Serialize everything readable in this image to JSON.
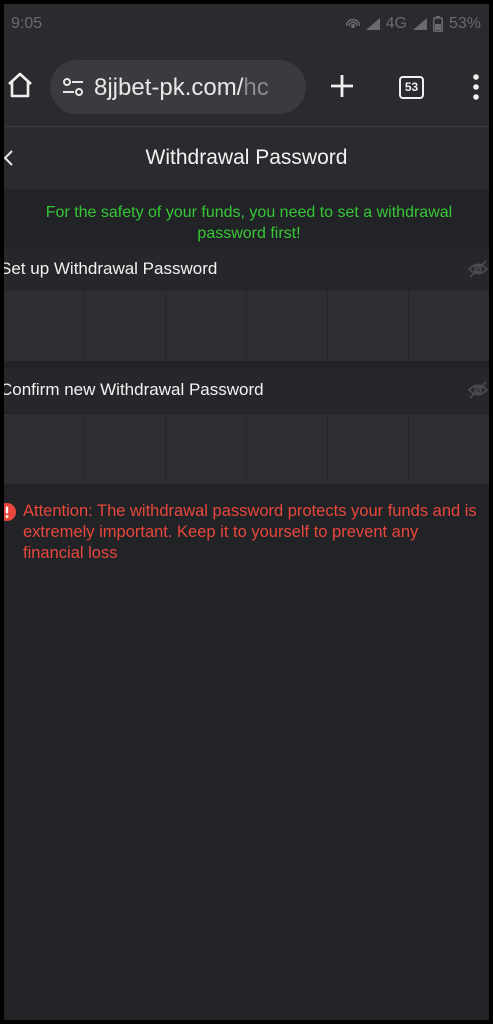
{
  "status_bar": {
    "time": "9:05",
    "network": "4G",
    "battery": "53%"
  },
  "browser": {
    "url_main": "8jjbet-pk.com/",
    "url_fade": "hc",
    "tab_count": "53"
  },
  "page": {
    "title": "Withdrawal Password"
  },
  "notice": {
    "text": "For the safety of your funds, you need to set a withdrawal password first!"
  },
  "fields": [
    {
      "label": "Set up Withdrawal Password"
    },
    {
      "label": "Confirm new Withdrawal Password"
    }
  ],
  "attention": {
    "text": "Attention: The withdrawal password protects your funds and is extremely important. Keep it to yourself to prevent any financial loss"
  },
  "colors": {
    "notice": "#36c736",
    "attention": "#e8473c",
    "background": "#222326"
  }
}
